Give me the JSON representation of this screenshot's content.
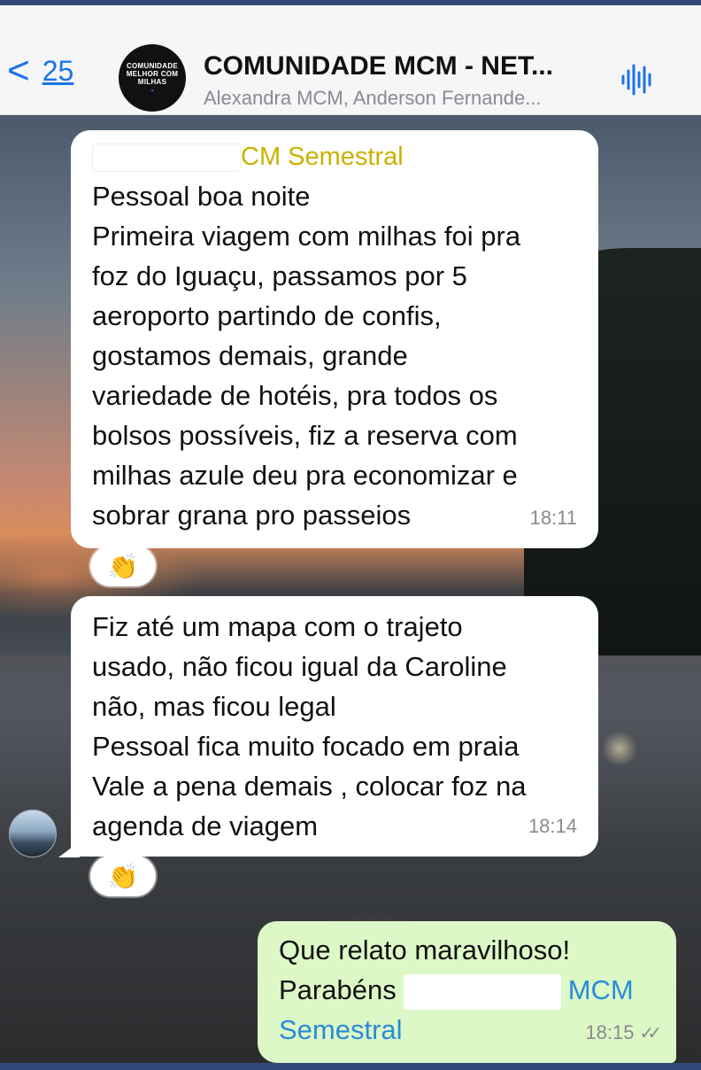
{
  "header": {
    "back_chevron": "<",
    "unread_count": "25",
    "group_title": "COMUNIDADE MCM - NET...",
    "participants": "Alexandra MCM, Anderson Fernande...",
    "avatar_text": "COMUNIDADE MELHOR COM MILHAS",
    "icons": [
      "chevron-left-icon",
      "audio-wave-icon"
    ]
  },
  "messages": [
    {
      "sender": "CM Semestral",
      "lines": [
        "Pessoal boa noite",
        "Primeira viagem com milhas foi pra",
        "foz do Iguaçu, passamos por 5",
        "aeroporto partindo de confis,",
        "gostamos demais, grande",
        "variedade de hotéis, pra todos os",
        "bolsos possíveis, fiz a reserva com",
        "milhas azule deu pra economizar e",
        "sobrar grana pro passeios"
      ],
      "time": "18:11",
      "reaction": "👏"
    },
    {
      "lines": [
        "Fiz até um mapa com o trajeto",
        "usado, não ficou igual da Caroline",
        "não, mas ficou legal",
        "Pessoal fica muito focado em praia",
        "Vale a pena demais , colocar foz na",
        "agenda de viagem"
      ],
      "time": "18:14",
      "reaction": "👏"
    },
    {
      "outgoing": true,
      "line1": "Que relato maravilhoso!",
      "line2_prefix": "Parabéns",
      "mention_part1": "MCM",
      "mention_part2": "Semestral",
      "time": "18:15",
      "status": "read"
    }
  ],
  "colors": {
    "accent": "#1a73e8",
    "sender_name": "#c9b200",
    "outgoing_bubble": "#dcf8c6",
    "mention": "#2a8bd8"
  }
}
